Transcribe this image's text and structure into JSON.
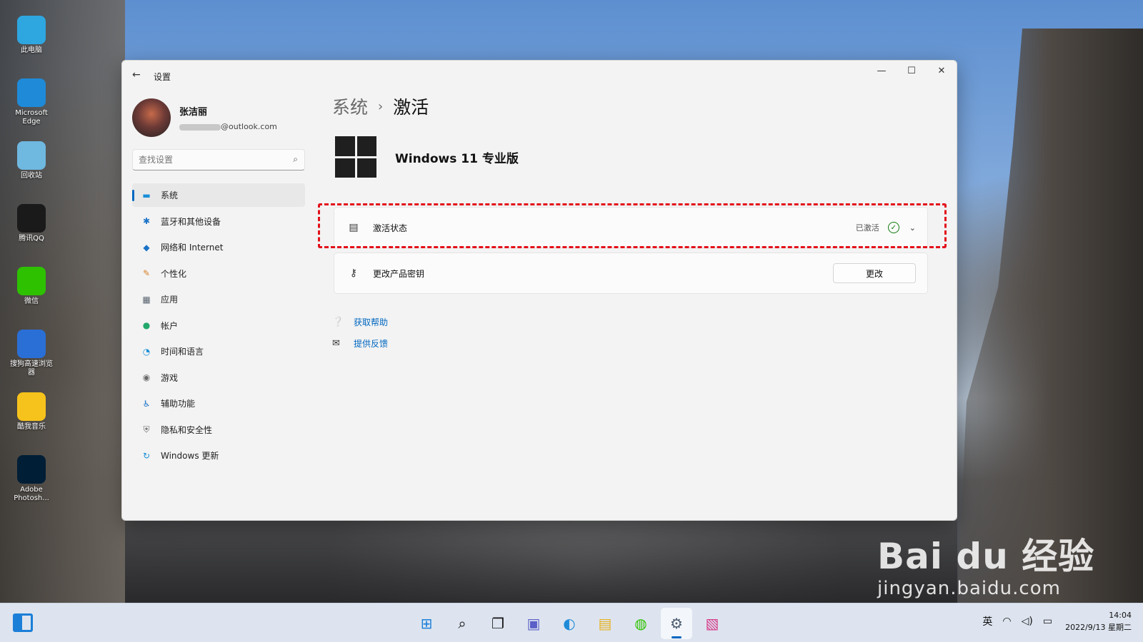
{
  "desktop": {
    "icons": [
      {
        "label": "此电脑",
        "icon": "monitor-icon",
        "color": "#2ea6e0"
      },
      {
        "label": "Microsoft Edge",
        "icon": "edge-icon",
        "color": "#1f8ad8"
      },
      {
        "label": "回收站",
        "icon": "recycle-bin-icon",
        "color": "#6fb8e0"
      },
      {
        "label": "腾讯QQ",
        "icon": "qq-penguin-icon",
        "color": "#1a1a1a"
      },
      {
        "label": "微信",
        "icon": "wechat-icon",
        "color": "#2dc100"
      },
      {
        "label": "搜狗高速浏览器",
        "icon": "sogou-browser-icon",
        "color": "#2a6fd6"
      },
      {
        "label": "酷我音乐",
        "icon": "kuwo-music-icon",
        "color": "#f6c31c"
      },
      {
        "label": "Adobe Photosh...",
        "icon": "photoshop-icon",
        "color": "#001e36"
      }
    ]
  },
  "window": {
    "app_title": "设置",
    "back_glyph": "←",
    "controls": {
      "minimize": "—",
      "maximize": "☐",
      "close": "✕"
    }
  },
  "profile": {
    "name": "张洁丽",
    "email_visible": "@outlook.com"
  },
  "search": {
    "placeholder": "查找设置",
    "icon_glyph": "⌕"
  },
  "nav": {
    "items": [
      {
        "label": "系统",
        "icon": "system-display-icon",
        "glyph": "▬",
        "color": "#1a8fd8",
        "active": true
      },
      {
        "label": "蓝牙和其他设备",
        "icon": "bluetooth-icon",
        "glyph": "✱",
        "color": "#1a73c8",
        "active": false
      },
      {
        "label": "网络和 Internet",
        "icon": "wifi-icon",
        "glyph": "◆",
        "color": "#1a73c8",
        "active": false
      },
      {
        "label": "个性化",
        "icon": "brush-icon",
        "glyph": "✎",
        "color": "#d9822b",
        "active": false
      },
      {
        "label": "应用",
        "icon": "apps-icon",
        "glyph": "▦",
        "color": "#5a6470",
        "active": false
      },
      {
        "label": "帐户",
        "icon": "account-icon",
        "glyph": "●",
        "color": "#23a86b",
        "active": false
      },
      {
        "label": "时间和语言",
        "icon": "globe-clock-icon",
        "glyph": "◔",
        "color": "#1a8fd8",
        "active": false
      },
      {
        "label": "游戏",
        "icon": "gamepad-icon",
        "glyph": "◉",
        "color": "#6a6a6a",
        "active": false
      },
      {
        "label": "辅助功能",
        "icon": "accessibility-icon",
        "glyph": "♿",
        "color": "#1a73c8",
        "active": false
      },
      {
        "label": "隐私和安全性",
        "icon": "shield-icon",
        "glyph": "⛨",
        "color": "#6a6a6a",
        "active": false
      },
      {
        "label": "Windows 更新",
        "icon": "windows-update-icon",
        "glyph": "↻",
        "color": "#1a8fd8",
        "active": false
      }
    ]
  },
  "main": {
    "breadcrumb_parent": "系统",
    "breadcrumb_sep": "›",
    "breadcrumb_current": "激活",
    "edition": "Windows 11 专业版",
    "activation": {
      "label": "激活状态",
      "status": "已激活",
      "check_glyph": "✓",
      "chevron_glyph": "⌄"
    },
    "product_key": {
      "label": "更改产品密钥",
      "button": "更改"
    },
    "links": [
      {
        "label": "获取帮助",
        "icon": "help-icon",
        "glyph": "❔"
      },
      {
        "label": "提供反馈",
        "icon": "feedback-icon",
        "glyph": "✉"
      }
    ],
    "highlight_color": "#e3101a",
    "accent_color": "#0067c0"
  },
  "watermark": {
    "main": "Bai du 经验",
    "sub": "jingyan.baidu.com"
  },
  "taskbar": {
    "apps": [
      {
        "name": "start",
        "glyph": "⊞",
        "color": "#1b7fd8",
        "active": false
      },
      {
        "name": "search",
        "glyph": "⌕",
        "color": "#111111",
        "active": false
      },
      {
        "name": "task-view",
        "glyph": "❐",
        "color": "#111111",
        "active": false
      },
      {
        "name": "chat",
        "glyph": "▣",
        "color": "#5b5fc7",
        "active": false
      },
      {
        "name": "edge",
        "glyph": "◐",
        "color": "#1f8ad8",
        "active": false
      },
      {
        "name": "file-explorer",
        "glyph": "▤",
        "color": "#e8b21f",
        "active": false
      },
      {
        "name": "wechat",
        "glyph": "◍",
        "color": "#2dc100",
        "active": false
      },
      {
        "name": "settings",
        "glyph": "⚙",
        "color": "#4a5a70",
        "active": true
      },
      {
        "name": "image-editor",
        "glyph": "▧",
        "color": "#d63a8a",
        "active": false
      }
    ],
    "tray": {
      "ime": "英",
      "wifi_glyph": "◠",
      "volume_glyph": "◁)",
      "battery_glyph": "▭"
    },
    "time": "14:04",
    "date": "2022/9/13 星期二"
  }
}
